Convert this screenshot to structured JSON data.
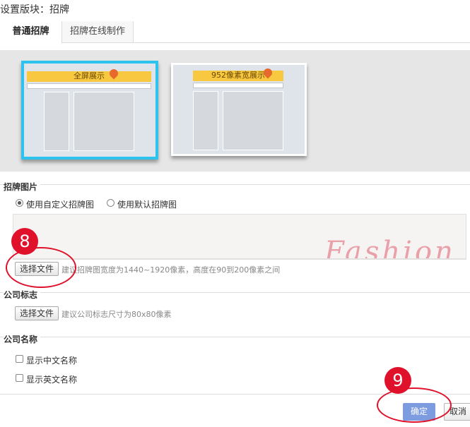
{
  "dialog": {
    "title": "设置版块：招牌"
  },
  "tabs": [
    {
      "label": "普通招牌",
      "active": true
    },
    {
      "label": "招牌在线制作",
      "active": false
    }
  ],
  "templates": [
    {
      "banner_label": "全屏展示",
      "selected": true
    },
    {
      "banner_label": "952像素宽展示",
      "selected": false
    }
  ],
  "signboard_image": {
    "section_title": "招牌图片",
    "radio_custom": "使用自定义招牌图",
    "radio_default": "使用默认招牌图",
    "selected": "custom",
    "preview_text": "Fashion",
    "choose_file": "选择文件",
    "hint": "建议招牌图宽度为1440~1920像素，高度在90到200像素之间"
  },
  "company_logo": {
    "section_title": "公司标志",
    "choose_file": "选择文件",
    "hint": "建议公司标志尺寸为80x80像素"
  },
  "company_name": {
    "section_title": "公司名称",
    "show_cn": "显示中文名称",
    "show_en": "显示英文名称"
  },
  "footer": {
    "ok": "确定",
    "cancel": "取消"
  },
  "callouts": [
    {
      "number": "8"
    },
    {
      "number": "9"
    }
  ],
  "colors": {
    "selected_border": "#2cc3ef",
    "callout_red": "#e0112b",
    "ok_button": "#7d9ce0",
    "banner_yellow": "#f8c840"
  }
}
